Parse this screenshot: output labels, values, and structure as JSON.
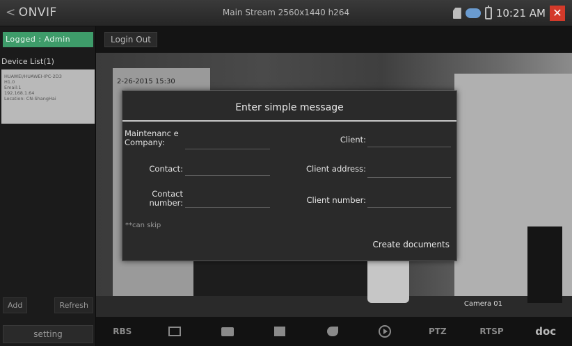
{
  "statusbar": {
    "app_title": "ONVIF",
    "stream_info": "Main Stream 2560x1440 h264",
    "clock": "10:21 AM"
  },
  "sidebar": {
    "login_status": "Logged : Admin",
    "device_list_label": "Device List(1)",
    "device_card": [
      "HUAWEI/HUAWEI-IPC-2D3",
      "H1.0",
      "Email:1",
      "192.168.1.64",
      "Location: CN-ShangHai"
    ],
    "add_label": "Add",
    "refresh_label": "Refresh",
    "setting_label": "setting"
  },
  "toolbar": {
    "logout_label": "Login Out"
  },
  "video": {
    "osd_timestamp": "2-26-2015 15:30",
    "osd_camera": "Camera 01"
  },
  "bottombar": {
    "items": [
      "RBS",
      "PTZ",
      "RTSP",
      "doc"
    ]
  },
  "dialog": {
    "title": "Enter simple message",
    "maintenance_company_label": "Maintenanc e Company:",
    "contact_label": "Contact:",
    "contact_number_label": "Contact number:",
    "client_label": "Client:",
    "client_address_label": "Client address:",
    "client_number_label": "Client number:",
    "skip_note": "**can skip",
    "create_label": "Create documents"
  }
}
